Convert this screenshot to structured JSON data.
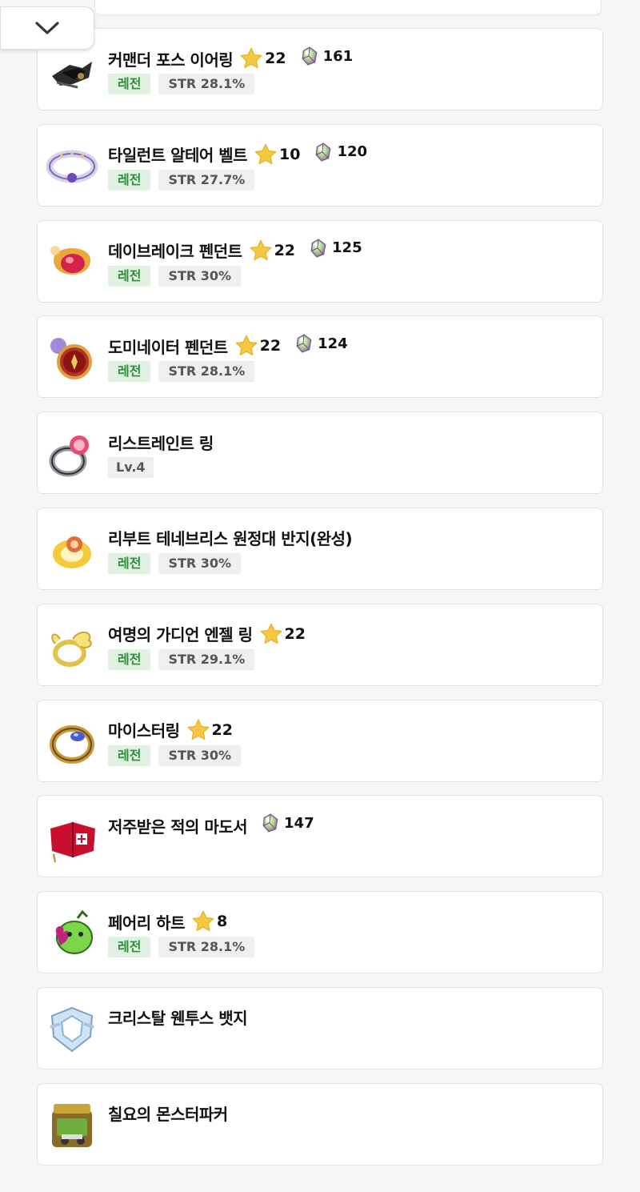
{
  "items": [
    {
      "name": "커맨더 포스 이어링",
      "star": "22",
      "gem": "161",
      "grade": "레전",
      "stat": "STR 28.1%",
      "icon": "commander-force-earring-icon"
    },
    {
      "name": "타일런트 알테어 벨트",
      "star": "10",
      "gem": "120",
      "grade": "레전",
      "stat": "STR 27.7%",
      "icon": "tyrant-altair-belt-icon"
    },
    {
      "name": "데이브레이크 펜던트",
      "star": "22",
      "gem": "125",
      "grade": "레전",
      "stat": "STR 30%",
      "icon": "daybreak-pendant-icon"
    },
    {
      "name": "도미네이터 펜던트",
      "star": "22",
      "gem": "124",
      "grade": "레전",
      "stat": "STR 28.1%",
      "icon": "dominator-pendant-icon"
    },
    {
      "name": "리스트레인트 링",
      "level": "Lv.4",
      "icon": "restraint-ring-icon"
    },
    {
      "name": "리부트 테네브리스 원정대 반지(완성)",
      "grade": "레전",
      "stat": "STR 30%",
      "icon": "tenebris-ring-icon"
    },
    {
      "name": "여명의 가디언 엔젤 링",
      "star": "22",
      "grade": "레전",
      "stat": "STR 29.1%",
      "icon": "guardian-angel-ring-icon"
    },
    {
      "name": "마이스터링",
      "star": "22",
      "grade": "레전",
      "stat": "STR 30%",
      "icon": "meister-ring-icon"
    },
    {
      "name": "저주받은 적의 마도서",
      "gem": "147",
      "icon": "cursed-spellbook-icon"
    },
    {
      "name": "페어리 하트",
      "star": "8",
      "grade": "레전",
      "stat": "STR 28.1%",
      "icon": "fairy-heart-icon"
    },
    {
      "name": "크리스탈 웬투스 뱃지",
      "icon": "crystal-ventus-badge-icon"
    },
    {
      "name": "칠요의 몬스터파커",
      "icon": "monster-parker-icon"
    }
  ],
  "colors": {
    "grade_bg": "#e2f2e2",
    "grade_text": "#2f8c3f",
    "stat_bg": "#efeff1",
    "star": "#f5c842"
  }
}
